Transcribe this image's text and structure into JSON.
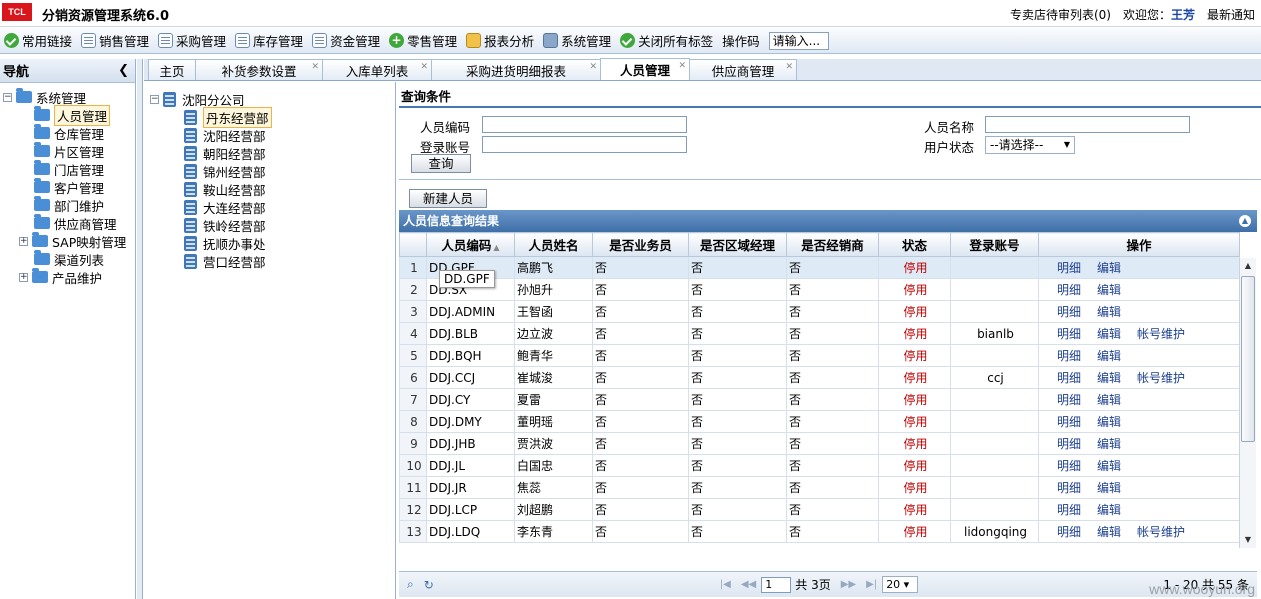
{
  "app": {
    "logo": "TCL",
    "title": "分销资源管理系统6.0"
  },
  "topbar": {
    "pending_list": "专卖店待审列表(0)",
    "welcome": "欢迎您：",
    "user": "王芳",
    "notice": "最新通知"
  },
  "toolbar": {
    "items": [
      {
        "label": "常用链接",
        "icon": "check-circle-icon"
      },
      {
        "label": "销售管理",
        "icon": "document-icon"
      },
      {
        "label": "采购管理",
        "icon": "edit-document-icon"
      },
      {
        "label": "库存管理",
        "icon": "document-icon"
      },
      {
        "label": "资金管理",
        "icon": "document-icon"
      },
      {
        "label": "零售管理",
        "icon": "plus-circle-icon"
      },
      {
        "label": "报表分析",
        "icon": "chart-icon"
      },
      {
        "label": "系统管理",
        "icon": "gear-icon"
      },
      {
        "label": "关闭所有标签",
        "icon": "check-circle-icon"
      }
    ],
    "opcode_label": "操作码",
    "opcode_placeholder": "请输入..."
  },
  "sidebar": {
    "title": "导航",
    "root": "系统管理",
    "items": [
      "人员管理",
      "仓库管理",
      "片区管理",
      "门店管理",
      "客户管理",
      "部门维护",
      "供应商管理",
      "SAP映射管理",
      "渠道列表",
      "产品维护"
    ]
  },
  "tabs": [
    "主页",
    "补货参数设置",
    "入库单列表",
    "采购进货明细报表",
    "人员管理",
    "供应商管理"
  ],
  "org": {
    "root": "沈阳分公司",
    "items": [
      "丹东经营部",
      "沈阳经营部",
      "朝阳经营部",
      "锦州经营部",
      "鞍山经营部",
      "大连经营部",
      "铁岭经营部",
      "抚顺办事处",
      "营口经营部"
    ]
  },
  "query": {
    "title": "查询条件",
    "code_label": "人员编码",
    "name_label": "人员名称",
    "login_label": "登录账号",
    "status_label": "用户状态",
    "status_value": "--请选择--",
    "query_button": "查询",
    "new_button": "新建人员"
  },
  "grid": {
    "title": "人员信息查询结果",
    "columns": [
      "人员编码",
      "人员姓名",
      "是否业务员",
      "是否区域经理",
      "是否经销商",
      "状态",
      "登录账号",
      "操作"
    ],
    "rows": [
      {
        "n": "1",
        "code": "DD.GPF",
        "name": "高鹏飞",
        "sales": "否",
        "area": "否",
        "dealer": "否",
        "status": "停用",
        "account": "",
        "ops": [
          "明细",
          "编辑"
        ]
      },
      {
        "n": "2",
        "code": "DD.SX",
        "name": "孙旭升",
        "sales": "否",
        "area": "否",
        "dealer": "否",
        "status": "停用",
        "account": "",
        "ops": [
          "明细",
          "编辑"
        ]
      },
      {
        "n": "3",
        "code": "DDJ.ADMIN",
        "name": "王智函",
        "sales": "否",
        "area": "否",
        "dealer": "否",
        "status": "停用",
        "account": "",
        "ops": [
          "明细",
          "编辑"
        ]
      },
      {
        "n": "4",
        "code": "DDJ.BLB",
        "name": "边立波",
        "sales": "否",
        "area": "否",
        "dealer": "否",
        "status": "停用",
        "account": "bianlb",
        "ops": [
          "明细",
          "编辑",
          "帐号维护"
        ]
      },
      {
        "n": "5",
        "code": "DDJ.BQH",
        "name": "鲍青华",
        "sales": "否",
        "area": "否",
        "dealer": "否",
        "status": "停用",
        "account": "",
        "ops": [
          "明细",
          "编辑"
        ]
      },
      {
        "n": "6",
        "code": "DDJ.CCJ",
        "name": "崔城浚",
        "sales": "否",
        "area": "否",
        "dealer": "否",
        "status": "停用",
        "account": "ccj",
        "ops": [
          "明细",
          "编辑",
          "帐号维护"
        ]
      },
      {
        "n": "7",
        "code": "DDJ.CY",
        "name": "夏雷",
        "sales": "否",
        "area": "否",
        "dealer": "否",
        "status": "停用",
        "account": "",
        "ops": [
          "明细",
          "编辑"
        ]
      },
      {
        "n": "8",
        "code": "DDJ.DMY",
        "name": "董明瑶",
        "sales": "否",
        "area": "否",
        "dealer": "否",
        "status": "停用",
        "account": "",
        "ops": [
          "明细",
          "编辑"
        ]
      },
      {
        "n": "9",
        "code": "DDJ.JHB",
        "name": "贾洪波",
        "sales": "否",
        "area": "否",
        "dealer": "否",
        "status": "停用",
        "account": "",
        "ops": [
          "明细",
          "编辑"
        ]
      },
      {
        "n": "10",
        "code": "DDJ.JL",
        "name": "白国忠",
        "sales": "否",
        "area": "否",
        "dealer": "否",
        "status": "停用",
        "account": "",
        "ops": [
          "明细",
          "编辑"
        ]
      },
      {
        "n": "11",
        "code": "DDJ.JR",
        "name": "焦蕊",
        "sales": "否",
        "area": "否",
        "dealer": "否",
        "status": "停用",
        "account": "",
        "ops": [
          "明细",
          "编辑"
        ]
      },
      {
        "n": "12",
        "code": "DDJ.LCP",
        "name": "刘超鹏",
        "sales": "否",
        "area": "否",
        "dealer": "否",
        "status": "停用",
        "account": "",
        "ops": [
          "明细",
          "编辑"
        ]
      },
      {
        "n": "13",
        "code": "DDJ.LDQ",
        "name": "李东青",
        "sales": "否",
        "area": "否",
        "dealer": "否",
        "status": "停用",
        "account": "lidongqing",
        "ops": [
          "明细",
          "编辑",
          "帐号维护"
        ]
      }
    ],
    "tooltip": "DD.GPF"
  },
  "pager": {
    "page": "1",
    "of_label": "共",
    "pages": "3页",
    "page_size": "20",
    "summary": "1 - 20  共 55 条"
  },
  "watermark": "www.wooyun.org",
  "colors": {
    "accent": "#3f6fa8",
    "status_disabled": "#c00000",
    "link": "#1c3f8f",
    "brand_red": "#d9161c"
  }
}
